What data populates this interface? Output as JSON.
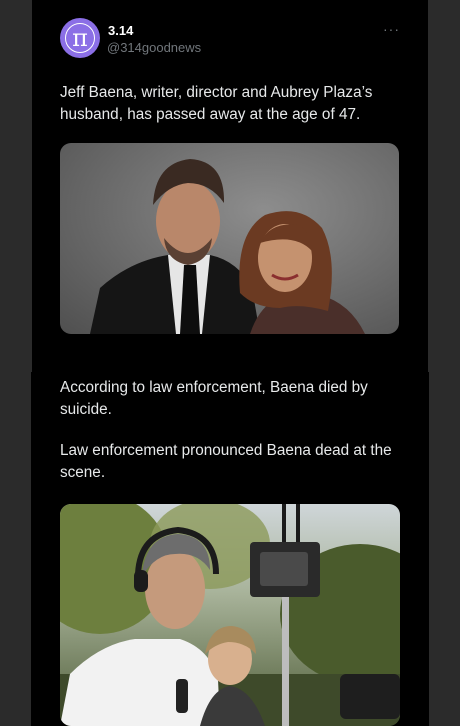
{
  "post": {
    "author_name": "3.14",
    "author_handle": "@314goodnews",
    "avatar_glyph": "π",
    "more_glyph": "···",
    "paragraphs": [
      "Jeff Baena, writer, director and Aubrey Plaza’s husband, has passed away at the age of 47.",
      "According to law enforcement, Baena died by suicide.",
      "Law enforcement pronounced Baena dead at the scene."
    ]
  },
  "colors": {
    "background": "#2b2b2b",
    "panel": "#000000",
    "avatar": "#8b6fe6",
    "text": "#e7e9ea",
    "muted": "#71767b"
  },
  "icons": [
    "pi-avatar-icon",
    "more-options-icon"
  ]
}
